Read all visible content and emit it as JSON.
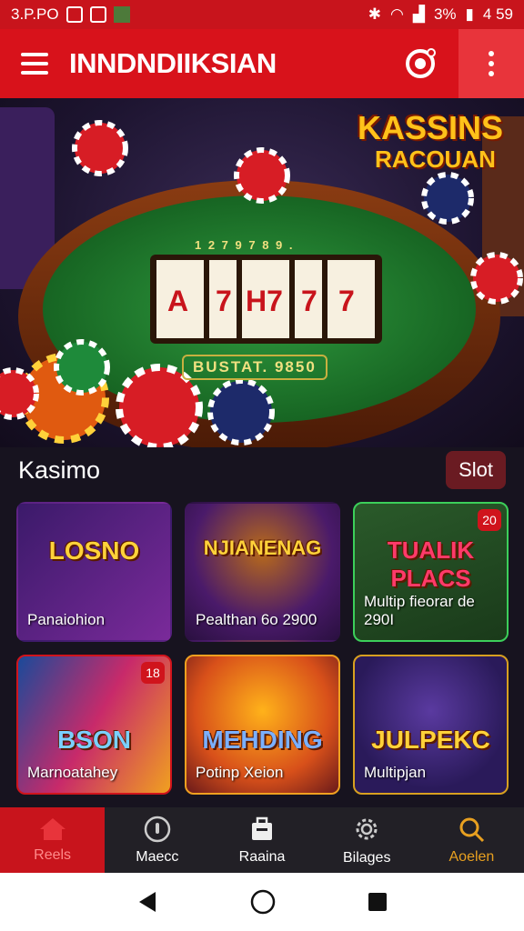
{
  "status_bar": {
    "time": "3.P.PO",
    "battery_text": "3%",
    "clock_right": "4 59"
  },
  "app_bar": {
    "title": "INNDNDIIKSIAN"
  },
  "hero": {
    "logo_line1": "KASSINS",
    "logo_line2": "RACOUAN",
    "table_text_top": "1 2 7 9 7 8 9 .",
    "table_text_bottom": "BUSTAT. 9850",
    "reel_symbols": [
      "A",
      "7",
      "H7",
      "7",
      "7"
    ]
  },
  "section": {
    "title": "Kasimo",
    "slot_button": "Slot"
  },
  "cards": [
    {
      "art": "LOSNO",
      "label": "Panaiohion",
      "badge": ""
    },
    {
      "art": "NJIANENAG",
      "label": "Pealthan 6o 2900",
      "badge": ""
    },
    {
      "art": "TUALIK PLACS",
      "label": "Multip fieorar de 290I",
      "badge": "20"
    },
    {
      "art": "BSON",
      "label": "Marnoatahey",
      "badge": "18"
    },
    {
      "art": "MEHDING",
      "label": "Potinp Xeion",
      "badge": ""
    },
    {
      "art": "JULPEKC",
      "label": "Multipjan",
      "badge": ""
    }
  ],
  "bottom_nav": [
    {
      "label": "Reels",
      "icon": "home-icon"
    },
    {
      "label": "Maecc",
      "icon": "dial-icon"
    },
    {
      "label": "Raaina",
      "icon": "bag-icon"
    },
    {
      "label": "Bilages",
      "icon": "gear-icon"
    },
    {
      "label": "Aoelen",
      "icon": "search-icon"
    }
  ],
  "colors": {
    "primary": "#d8121b",
    "nav_bg": "#222026",
    "bg": "#17131f",
    "gold": "#e8a020"
  }
}
